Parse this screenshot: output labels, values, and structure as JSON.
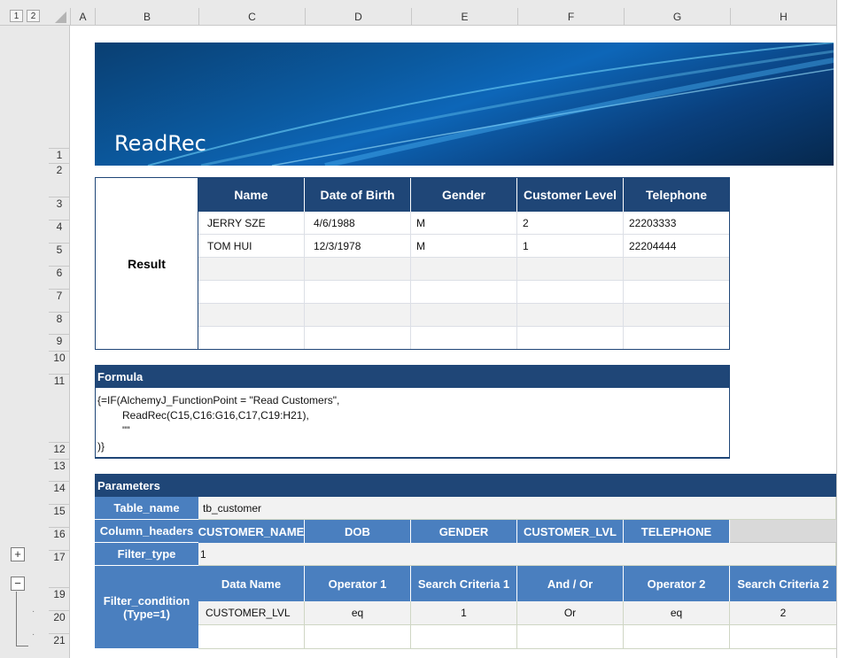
{
  "outline": {
    "levels": [
      "1",
      "2"
    ],
    "expand_symbol": "+",
    "collapse_symbol": "−"
  },
  "columns": [
    "A",
    "B",
    "C",
    "D",
    "E",
    "F",
    "G",
    "H"
  ],
  "rows": [
    "1",
    "2",
    "3",
    "4",
    "5",
    "6",
    "7",
    "8",
    "9",
    "10",
    "11",
    "12",
    "13",
    "14",
    "15",
    "16",
    "17",
    "19",
    "20",
    "21"
  ],
  "banner": {
    "title": "ReadRec"
  },
  "result": {
    "label": "Result",
    "headers": [
      "Name",
      "Date of Birth",
      "Gender",
      "Customer Level",
      "Telephone"
    ],
    "rows": [
      [
        "JERRY SZE",
        "4/6/1988",
        "M",
        "2",
        "22203333"
      ],
      [
        "TOM HUI",
        "12/3/1978",
        "M",
        "1",
        "22204444"
      ]
    ]
  },
  "formula": {
    "title": "Formula",
    "lines": [
      "{=IF(AlchemyJ_FunctionPoint = \"Read Customers\",",
      "ReadRec(C15,C16:G16,C17,C19:H21),",
      "\"\"",
      ")}"
    ]
  },
  "parameters": {
    "title": "Parameters",
    "table_name_label": "Table_name",
    "table_name_value": "tb_customer",
    "column_headers_label": "Column_headers",
    "column_headers": [
      "CUSTOMER_NAME",
      "DOB",
      "GENDER",
      "CUSTOMER_LVL",
      "TELEPHONE"
    ],
    "filter_type_label": "Filter_type",
    "filter_type_value": "1",
    "filter_condition_label_1": "Filter_condition",
    "filter_condition_label_2": "(Type=1)",
    "filter_headers": [
      "Data Name",
      "Operator 1",
      "Search Criteria 1",
      "And / Or",
      "Operator 2",
      "Search Criteria 2"
    ],
    "filter_row": [
      "CUSTOMER_LVL",
      "eq",
      "1",
      "Or",
      "eq",
      "2"
    ]
  },
  "colors": {
    "dark_blue": "#1f4677",
    "mid_blue": "#4a7fbf",
    "grey_row": "#f2f2f2"
  }
}
